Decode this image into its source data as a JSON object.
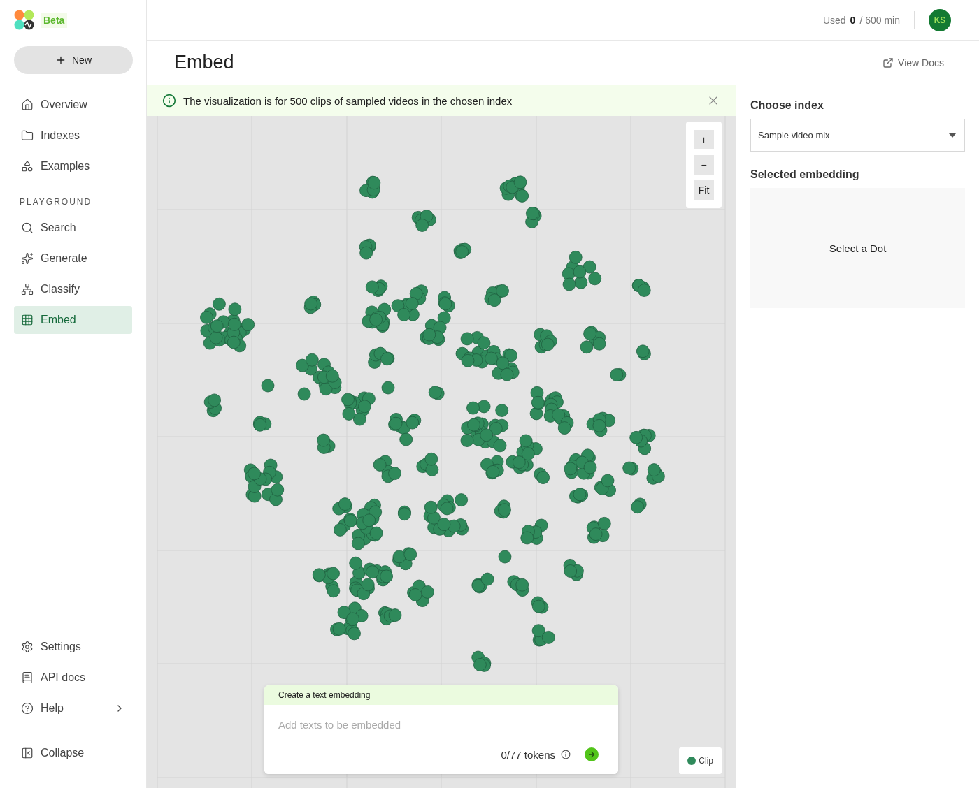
{
  "logo": {
    "badge": "Beta"
  },
  "new_button": {
    "label": "New"
  },
  "nav": [
    {
      "label": "Overview",
      "selected": false
    },
    {
      "label": "Indexes",
      "selected": false
    },
    {
      "label": "Examples",
      "selected": false
    }
  ],
  "section_label": "PLAYGROUND",
  "playground": [
    {
      "label": "Search",
      "selected": false
    },
    {
      "label": "Generate",
      "selected": false
    },
    {
      "label": "Classify",
      "selected": false
    },
    {
      "label": "Embed",
      "selected": true
    }
  ],
  "bottom_nav": [
    {
      "label": "Settings",
      "has_submenu": false
    },
    {
      "label": "API docs",
      "has_submenu": false
    },
    {
      "label": "Help",
      "has_submenu": true
    }
  ],
  "collapse": {
    "label": "Collapse"
  },
  "usage": {
    "label": "Used",
    "value": "0",
    "total": "/ 600 min"
  },
  "avatar": {
    "initials": "KS"
  },
  "page": {
    "title": "Embed",
    "docs_link": "View Docs"
  },
  "banner": {
    "text": "The visualization is for 500 clips of sampled videos in the chosen index"
  },
  "zoom_controls": [
    "+",
    "−",
    "Fit"
  ],
  "embedding_box": {
    "title": "Create a text embedding",
    "placeholder": "Add texts to be embedded",
    "token_count": "0/77 tokens"
  },
  "legend": [
    {
      "label": "Clip"
    }
  ],
  "right_panel": {
    "index_label": "Choose index",
    "index_value": "Sample video mix",
    "selected_label": "Selected embedding",
    "empty_text": "Select a Dot"
  }
}
